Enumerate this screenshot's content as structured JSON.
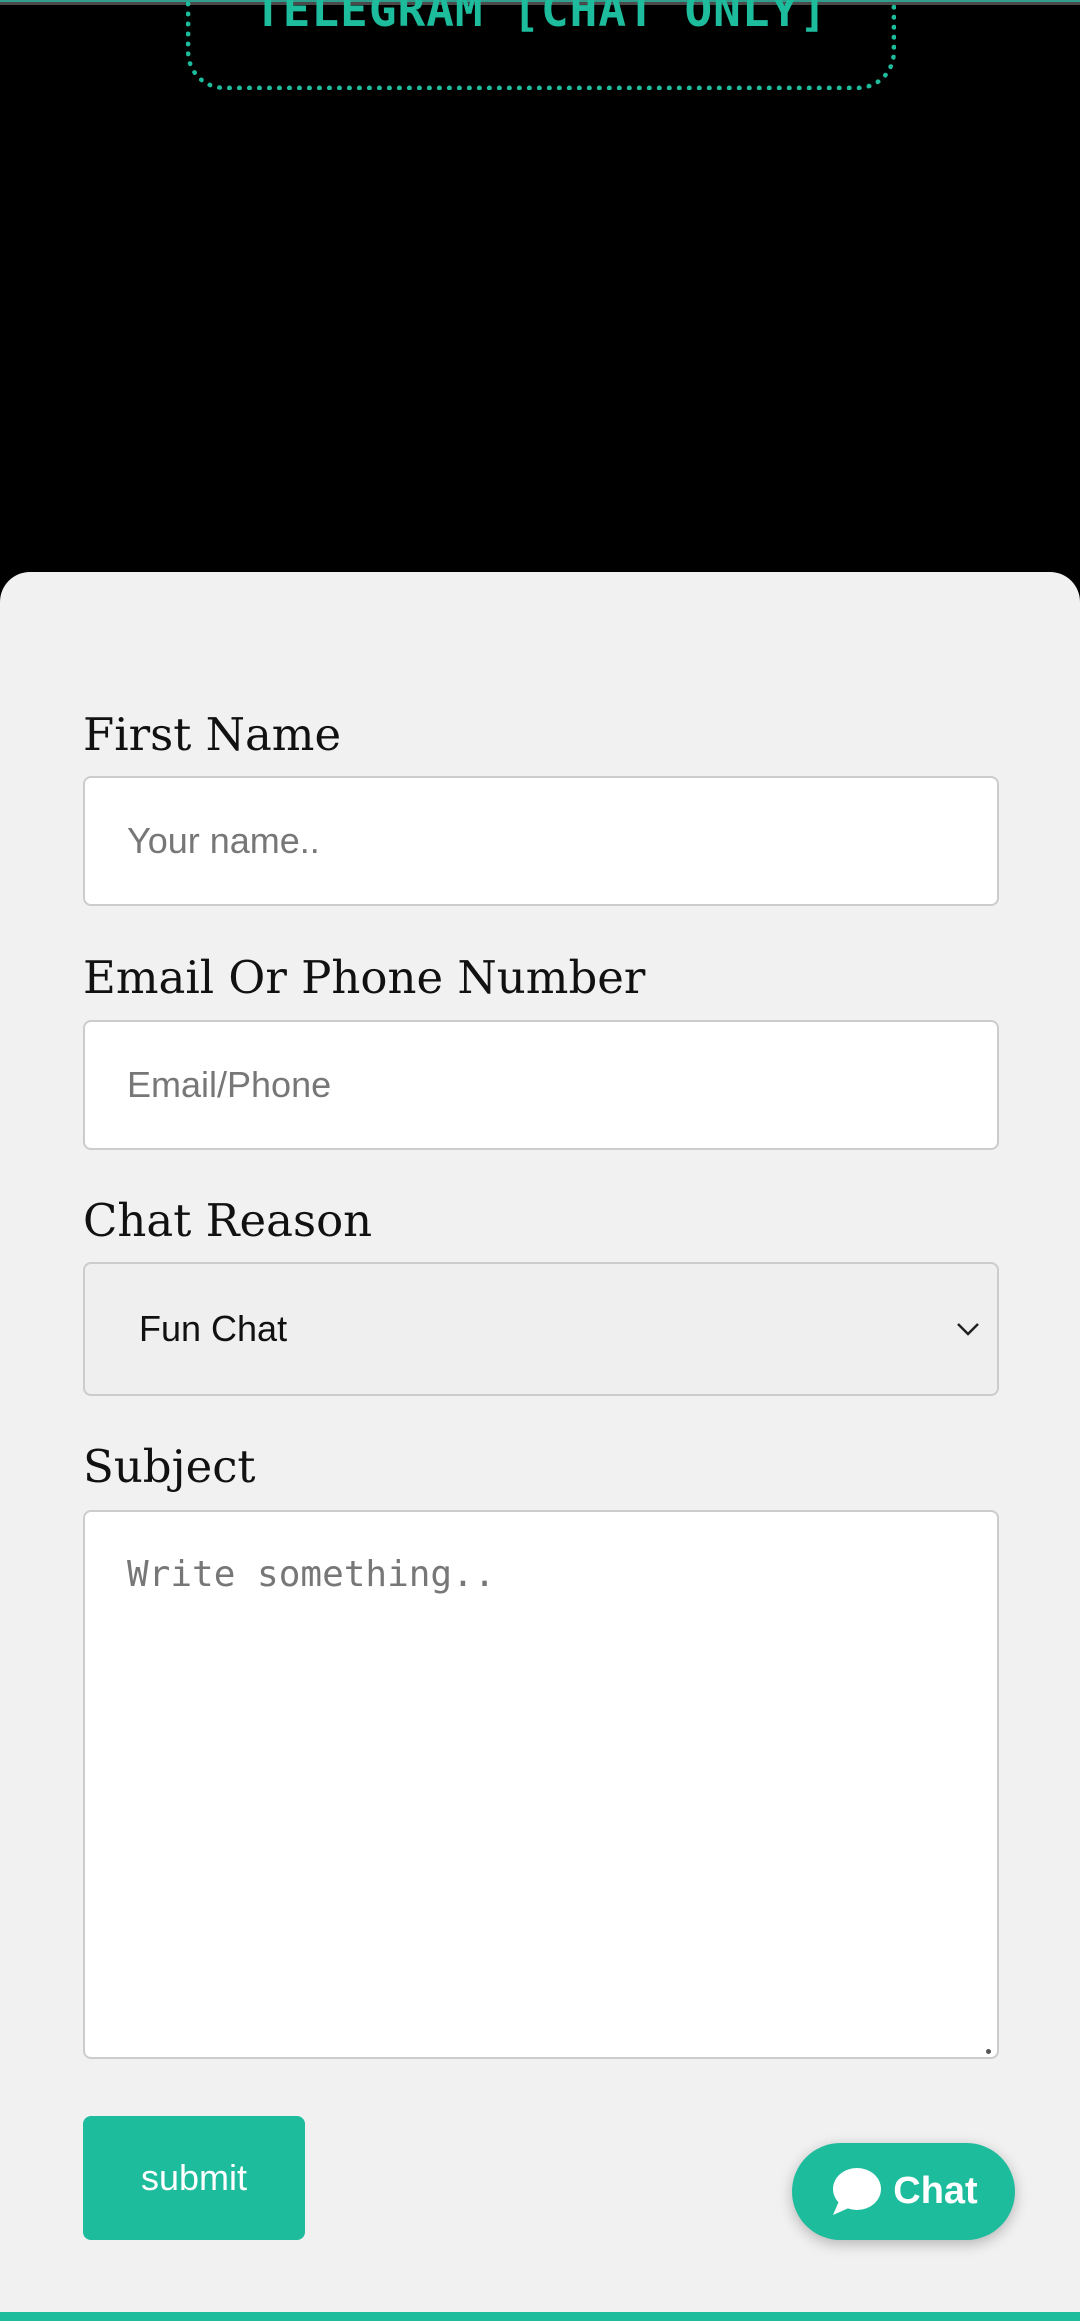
{
  "banner": {
    "telegram_text": "TELEGRAM [CHAT ONLY]"
  },
  "form": {
    "first_name": {
      "label": "First Name",
      "placeholder": "Your name..",
      "value": ""
    },
    "contact": {
      "label": "Email Or Phone Number",
      "placeholder": "Email/Phone",
      "value": ""
    },
    "chat_reason": {
      "label": "Chat Reason",
      "selected": "Fun Chat"
    },
    "subject": {
      "label": "Subject",
      "placeholder": "Write something..",
      "value": ""
    },
    "submit_label": "submit"
  },
  "chat_widget": {
    "label": "Chat",
    "icon": "speech-bubble-icon"
  },
  "colors": {
    "accent": "#1dbc9c",
    "background": "#000000",
    "card": "#f1f1f1"
  }
}
